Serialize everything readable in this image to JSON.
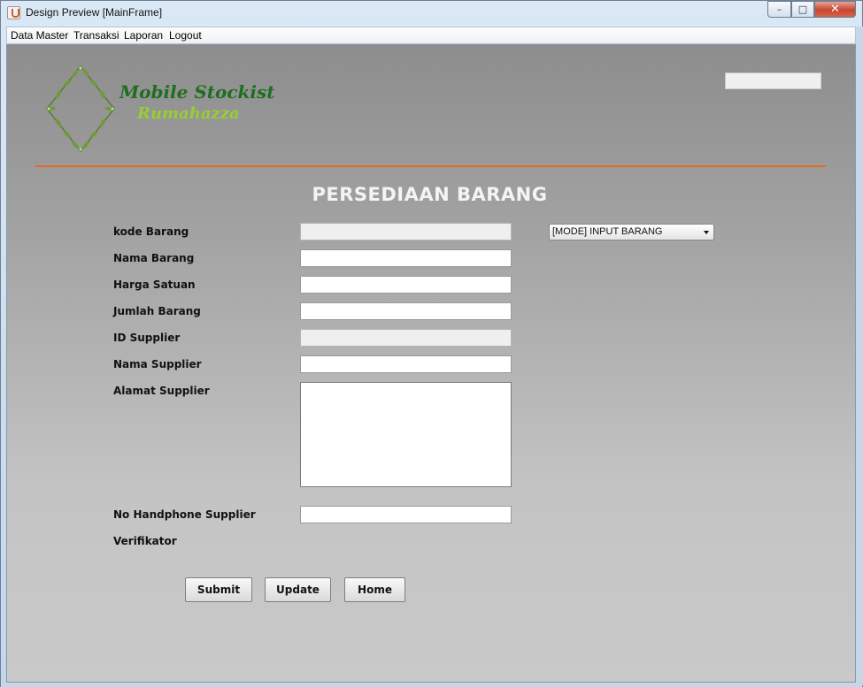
{
  "window": {
    "title": "Design Preview [MainFrame]",
    "controls": {
      "minimize": "–",
      "maximize": "□",
      "close": "✕"
    }
  },
  "menu": [
    "Data Master",
    "Transaksi",
    "Laporan",
    "Logout"
  ],
  "brand": {
    "name": "Mobile Stockist",
    "subtitle": "Rumahazza"
  },
  "page_title": "PERSEDIAAN BARANG",
  "form": {
    "labels": {
      "kode": "kode Barang",
      "nama": "Nama Barang",
      "harga": "Harga Satuan",
      "jumlah": "Jumlah Barang",
      "id_supplier": "ID Supplier",
      "nama_supplier": "Nama Supplier",
      "alamat_supplier": "Alamat Supplier",
      "hp_supplier": "No Handphone Supplier",
      "verifikator": "Verifikator"
    },
    "values": {
      "kode": "",
      "nama": "",
      "harga": "",
      "jumlah": "",
      "id_supplier": "",
      "nama_supplier": "",
      "alamat_supplier": "",
      "hp_supplier": ""
    },
    "mode_select": "[MODE] INPUT BARANG"
  },
  "buttons": {
    "submit": "Submit",
    "update": "Update",
    "home": "Home"
  },
  "colors": {
    "accent_line": "#e36b1f",
    "brand_primary": "#1f6e1f",
    "brand_secondary": "#9acd32"
  },
  "icons": [
    "java-app-icon",
    "leaf-wreath-logo-icon",
    "dropdown-arrow-icon"
  ]
}
